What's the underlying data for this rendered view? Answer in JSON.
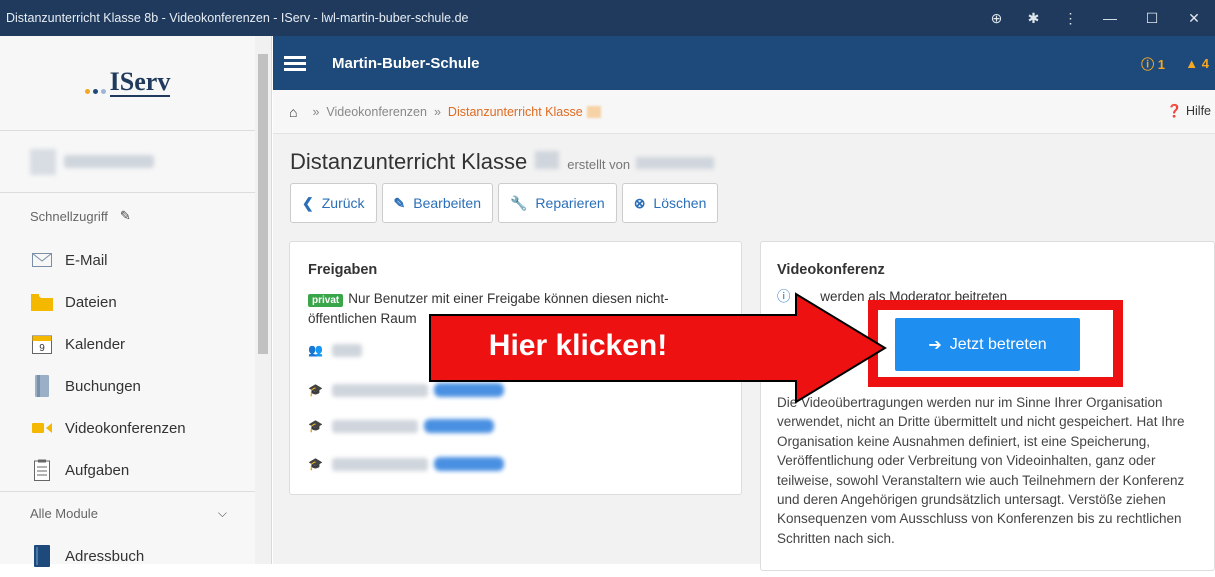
{
  "window": {
    "title": "Distanzunterricht Klasse 8b - Videokonferenzen - IServ - lwl-martin-buber-schule.de",
    "controls": [
      "⊕",
      "✱",
      "⋮",
      "—",
      "☐",
      "✕"
    ]
  },
  "sidebar": {
    "logo_text": "IServ",
    "logo_dot_colors": [
      "#f5a623",
      "#1d4a7a",
      "#9bb7d4"
    ],
    "quick_access_label": "Schnellzugriff",
    "items": [
      {
        "label": "E-Mail",
        "icon": "mail-icon"
      },
      {
        "label": "Dateien",
        "icon": "folder-icon"
      },
      {
        "label": "Kalender",
        "icon": "calendar-icon",
        "badge": "9"
      },
      {
        "label": "Buchungen",
        "icon": "booking-icon"
      },
      {
        "label": "Videokonferenzen",
        "icon": "video-icon"
      },
      {
        "label": "Aufgaben",
        "icon": "tasks-icon"
      }
    ],
    "all_modules_label": "Alle Module",
    "module_items": [
      {
        "label": "Adressbuch",
        "icon": "addressbook-icon"
      }
    ]
  },
  "topnav": {
    "school_name": "Martin-Buber-Schule",
    "info_count": "1",
    "alert_count": "4"
  },
  "breadcrumb": {
    "items": [
      "Videokonferenzen",
      "Distanzunterricht Klasse"
    ],
    "help_label": "Hilfe"
  },
  "page": {
    "title": "Distanzunterricht Klasse",
    "created_by_label": "erstellt von"
  },
  "toolbar": {
    "back_label": "Zurück",
    "edit_label": "Bearbeiten",
    "repair_label": "Reparieren",
    "delete_label": "Löschen"
  },
  "freigaben": {
    "heading": "Freigaben",
    "badge": "privat",
    "description": "Nur Benutzer mit einer Freigabe können diesen nicht-öffentlichen Raum"
  },
  "videokonferenz": {
    "heading": "Videokonferenz",
    "moderator_note": "werden als Moderator beitreten",
    "join_label": "Jetzt betreten",
    "notice": "Die Videoübertragungen werden nur im Sinne Ihrer Organisation verwendet, nicht an Dritte übermittelt und nicht gespeichert. Hat Ihre Organisation keine Ausnahmen definiert, ist eine Speicherung, Veröffentlichung oder Verbreitung von Videoinhalten, ganz oder teilweise, sowohl Veranstaltern wie auch Teilnehmern der Konferenz und deren Angehörigen grundsätzlich untersagt. Verstöße ziehen Konsequenzen vom Ausschluss von Konferenzen bis zu rechtlichen Schritten nach sich."
  },
  "annotation": {
    "arrow_label": "Hier klicken!",
    "color": "#ee1111"
  }
}
